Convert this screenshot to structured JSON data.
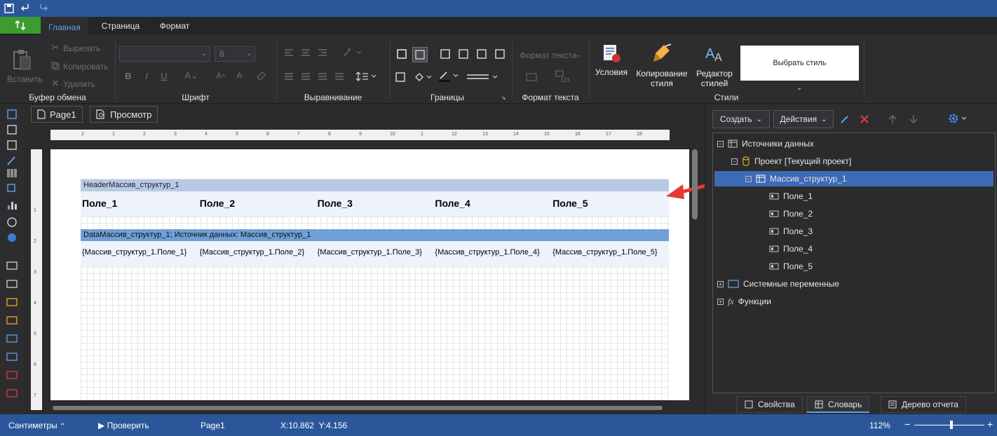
{
  "ribbon": {
    "tabs": [
      {
        "label": "Главная"
      },
      {
        "label": "Страница"
      },
      {
        "label": "Формат"
      }
    ],
    "clipboard": {
      "paste": "Вставить",
      "cut": "Вырезать",
      "copy": "Копировать",
      "delete": "Удалить",
      "group": "Буфер обмена"
    },
    "font": {
      "size": "8",
      "group": "Шрифт"
    },
    "alignment": {
      "group": "Выравнивание"
    },
    "borders": {
      "group": "Границы"
    },
    "text_format": {
      "button": "Формат текста",
      "group": "Формат текста"
    },
    "styles": {
      "conditions": "Условия",
      "copy_style_1": "Копирование",
      "copy_style_2": "стиля",
      "editor_1": "Редактор",
      "editor_2": "стилей",
      "choose": "Выбрать стиль",
      "group": "Стили"
    }
  },
  "page_tabs": {
    "page1": "Page1",
    "preview": "Просмотр"
  },
  "ruler": {
    "h_marks": [
      "2",
      "1",
      "2",
      "3",
      "4",
      "5",
      "6",
      "7",
      "8",
      "9",
      "10",
      "1",
      "12",
      "13",
      "14",
      "15",
      "16",
      "17",
      "18"
    ],
    "v_marks": [
      "1",
      "2",
      "3",
      "4",
      "5",
      "6",
      "7"
    ]
  },
  "report": {
    "header_band": "HeaderМассив_структур_1",
    "header_cells": [
      "Поле_1",
      "Поле_2",
      "Поле_3",
      "Поле_4",
      "Поле_5"
    ],
    "data_band": "DataМассив_структур_1; Источник данных: Массив_структур_1",
    "data_cells": [
      "{Массив_структур_1.Поле_1}",
      "{Массив_структур_1.Поле_2}",
      "{Массив_структур_1.Поле_3}",
      "{Массив_структур_1.Поле_4}",
      "{Массив_структур_1.Поле_5}"
    ]
  },
  "dictionary": {
    "create": "Создать",
    "actions": "Действия",
    "tree": {
      "data_sources": "Источники данных",
      "project": "Проект [Текущий проект]",
      "array": "Массив_структур_1",
      "fields": [
        "Поле_1",
        "Поле_2",
        "Поле_3",
        "Поле_4",
        "Поле_5"
      ],
      "system_vars": "Системные переменные",
      "functions": "Функции"
    },
    "tabs": {
      "properties": "Свойства",
      "dictionary": "Словарь",
      "report_tree": "Дерево отчета"
    }
  },
  "status": {
    "units": "Сантиметры",
    "check": "Проверить",
    "page": "Page1",
    "coords": "X:10.862  Y:4.156",
    "zoom": "112%"
  },
  "colors": {
    "accent": "#2b579a",
    "selection": "#3d6ab5",
    "band_header": "#b8c9e6",
    "band_data": "#6f9fd6",
    "arrow": "#e53935"
  }
}
